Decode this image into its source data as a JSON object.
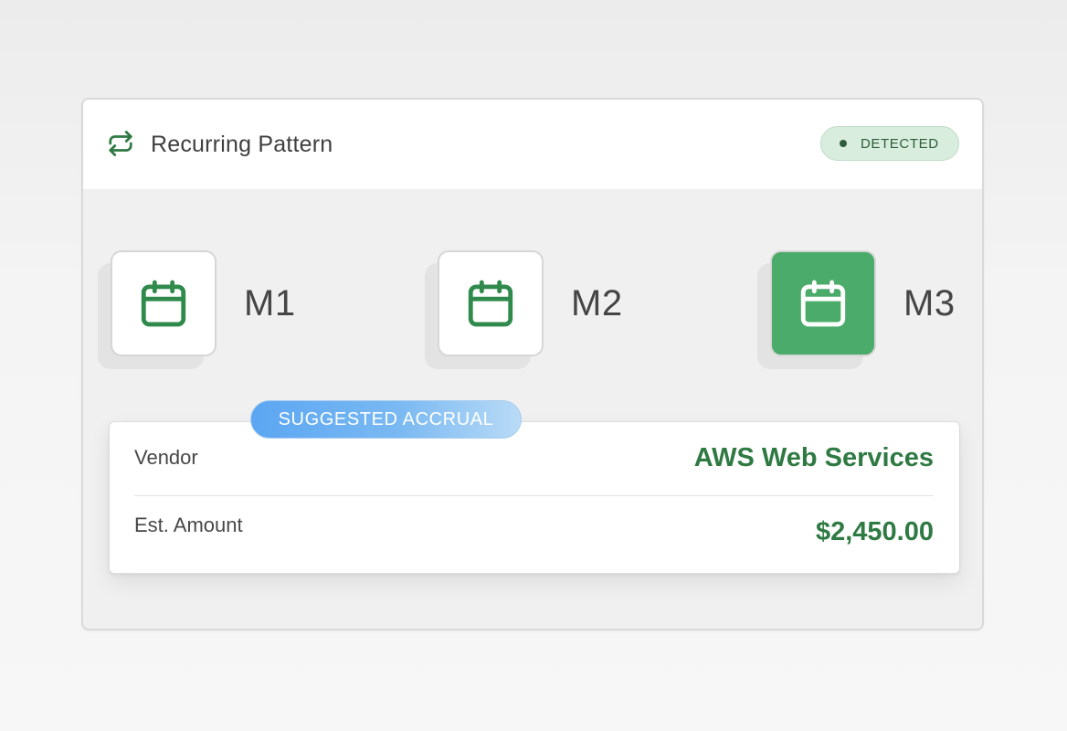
{
  "header": {
    "title": "Recurring Pattern",
    "icon": "repeat-icon",
    "status": "DETECTED",
    "status_color": "#2c5e3a",
    "status_bg": "#d8eddd"
  },
  "months": [
    {
      "label": "M1",
      "icon": "calendar-icon",
      "active": false
    },
    {
      "label": "M2",
      "icon": "calendar-icon",
      "active": false
    },
    {
      "label": "M3",
      "icon": "calendar-icon",
      "active": true
    }
  ],
  "accrual": {
    "badge": "SUGGESTED ACCRUAL",
    "vendor_label": "Vendor",
    "vendor_value": "AWS Web Services",
    "amount_label": "Est. Amount",
    "amount_value": "$2,450.00"
  },
  "colors": {
    "accent_green": "#2f7a43",
    "active_tile": "#4aab6a",
    "badge_blue": "#5ba6f2"
  }
}
